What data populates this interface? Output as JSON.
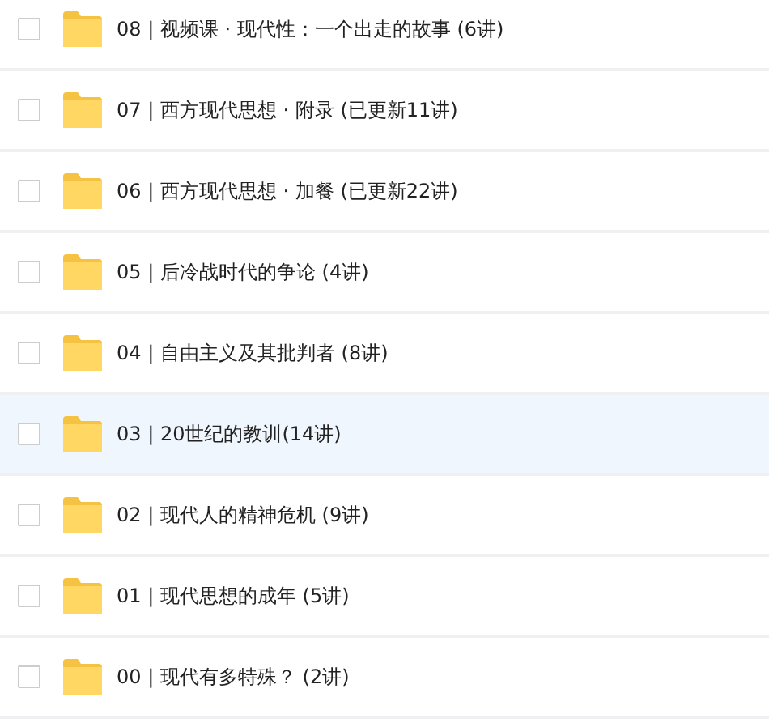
{
  "folders": [
    {
      "name": "08 | 视频课 · 现代性：一个出走的故事 (6讲)",
      "checked": false,
      "highlighted": false
    },
    {
      "name": "07 | 西方现代思想 · 附录 (已更新11讲)",
      "checked": false,
      "highlighted": false
    },
    {
      "name": "06 | 西方现代思想 · 加餐 (已更新22讲)",
      "checked": false,
      "highlighted": false
    },
    {
      "name": "05 | 后冷战时代的争论 (4讲)",
      "checked": false,
      "highlighted": false
    },
    {
      "name": "04 | 自由主义及其批判者 (8讲)",
      "checked": false,
      "highlighted": false
    },
    {
      "name": "03 | 20世纪的教训(14讲)",
      "checked": false,
      "highlighted": true
    },
    {
      "name": "02 | 现代人的精神危机 (9讲)",
      "checked": false,
      "highlighted": false
    },
    {
      "name": "01 | 现代思想的成年 (5讲)",
      "checked": false,
      "highlighted": false
    },
    {
      "name": "00 | 现代有多特殊？ (2讲)",
      "checked": false,
      "highlighted": false
    }
  ]
}
